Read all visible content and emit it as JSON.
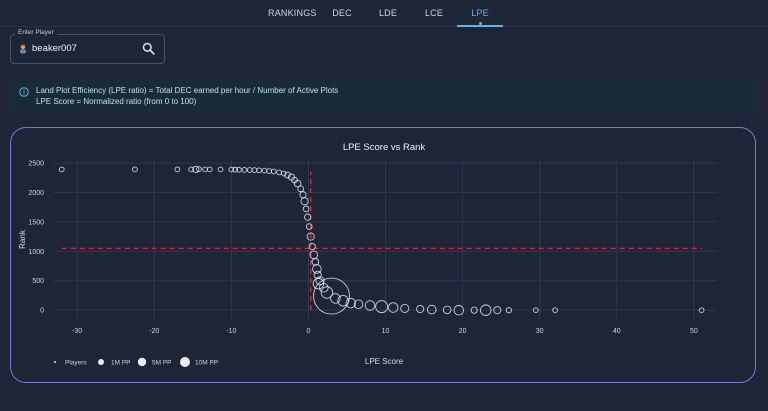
{
  "nav": {
    "tabs": [
      {
        "label": "RANKINGS",
        "active": false
      },
      {
        "label": "DEC",
        "active": false
      },
      {
        "label": "LDE",
        "active": false
      },
      {
        "label": "LCE",
        "active": false
      },
      {
        "label": "LPE",
        "active": true
      }
    ]
  },
  "player": {
    "label": "Enter Player",
    "value": "beaker007"
  },
  "info": {
    "line1": "Land Plot Efficiency (LPE ratio) = Total DEC earned per hour / Number of Active Plots",
    "line2": "LPE Score = Normalized ratio (from 0 to 100)"
  },
  "colors": {
    "background": "#1e2537",
    "accent": "#5fb4e8",
    "card_border": "#7f78d6",
    "info_bg": "#1a2b37",
    "reference_line": "#e0323c"
  },
  "chart_data": {
    "type": "scatter",
    "title": "LPE Score vs Rank",
    "xlabel": "LPE Score",
    "ylabel": "Rank",
    "xlim": [
      -33,
      53
    ],
    "ylim": [
      -150,
      2550
    ],
    "xticks": [
      -30,
      -20,
      -10,
      0,
      10,
      20,
      30,
      40,
      50
    ],
    "yticks": [
      0,
      500,
      1000,
      1500,
      2000,
      2500
    ],
    "grid": true,
    "legend_position": "bottom-left",
    "legend": [
      {
        "label": "Players",
        "marker": "dot"
      },
      {
        "label": "1M PP",
        "marker": "small-circle"
      },
      {
        "label": "5M PP",
        "marker": "medium-circle"
      },
      {
        "label": "10M PP",
        "marker": "large-circle"
      }
    ],
    "reference_lines": [
      {
        "orientation": "horizontal",
        "y": 1050,
        "x_from": -32,
        "x_to": 51
      },
      {
        "orientation": "vertical",
        "x": 0.3,
        "y_from": 0,
        "y_to": 2350
      }
    ],
    "series": [
      {
        "name": "Players",
        "points": [
          {
            "x": -32,
            "y": 2390,
            "size": 1
          },
          {
            "x": -22.5,
            "y": 2390,
            "size": 1
          },
          {
            "x": -17,
            "y": 2390,
            "size": 1
          },
          {
            "x": -15.2,
            "y": 2390,
            "size": 1
          },
          {
            "x": -14.6,
            "y": 2390,
            "size": 1.3
          },
          {
            "x": -14.2,
            "y": 2395,
            "size": 1
          },
          {
            "x": -13.4,
            "y": 2390,
            "size": 1
          },
          {
            "x": -12.8,
            "y": 2390,
            "size": 1
          },
          {
            "x": -11.4,
            "y": 2390,
            "size": 1
          },
          {
            "x": -10,
            "y": 2388,
            "size": 1
          },
          {
            "x": -9.5,
            "y": 2386,
            "size": 1
          },
          {
            "x": -9,
            "y": 2384,
            "size": 1
          },
          {
            "x": -8.3,
            "y": 2382,
            "size": 1
          },
          {
            "x": -7.6,
            "y": 2380,
            "size": 1
          },
          {
            "x": -7,
            "y": 2378,
            "size": 1
          },
          {
            "x": -6.4,
            "y": 2375,
            "size": 1
          },
          {
            "x": -5.7,
            "y": 2370,
            "size": 1
          },
          {
            "x": -5.1,
            "y": 2362,
            "size": 1
          },
          {
            "x": -4.5,
            "y": 2355,
            "size": 1
          },
          {
            "x": -3.8,
            "y": 2340,
            "size": 1
          },
          {
            "x": -3.2,
            "y": 2320,
            "size": 1
          },
          {
            "x": -2.7,
            "y": 2295,
            "size": 1.2
          },
          {
            "x": -2.2,
            "y": 2260,
            "size": 1.3
          },
          {
            "x": -1.8,
            "y": 2210,
            "size": 1.2
          },
          {
            "x": -1.4,
            "y": 2150,
            "size": 1.4
          },
          {
            "x": -1.0,
            "y": 2060,
            "size": 1.2
          },
          {
            "x": -0.7,
            "y": 1960,
            "size": 1.3
          },
          {
            "x": -0.5,
            "y": 1850,
            "size": 1.5
          },
          {
            "x": -0.3,
            "y": 1720,
            "size": 1.2
          },
          {
            "x": -0.1,
            "y": 1580,
            "size": 1.3
          },
          {
            "x": 0.1,
            "y": 1420,
            "size": 1.2
          },
          {
            "x": 0.3,
            "y": 1250,
            "size": 1.5
          },
          {
            "x": 0.5,
            "y": 1080,
            "size": 1.3
          },
          {
            "x": 0.7,
            "y": 940,
            "size": 1.6
          },
          {
            "x": 0.9,
            "y": 820,
            "size": 1.4
          },
          {
            "x": 1.1,
            "y": 700,
            "size": 1.8
          },
          {
            "x": 1.2,
            "y": 600,
            "size": 1.5
          },
          {
            "x": 1.5,
            "y": 500,
            "size": 1.7
          },
          {
            "x": 1.3,
            "y": 450,
            "size": 2.2
          },
          {
            "x": 2.0,
            "y": 380,
            "size": 1.8
          },
          {
            "x": 3.0,
            "y": 240,
            "size": 7.5
          },
          {
            "x": 2.4,
            "y": 300,
            "size": 2.4
          },
          {
            "x": 3.5,
            "y": 200,
            "size": 2.0
          },
          {
            "x": 4.5,
            "y": 160,
            "size": 2.2
          },
          {
            "x": 5.5,
            "y": 120,
            "size": 2.0
          },
          {
            "x": 6.5,
            "y": 100,
            "size": 1.8
          },
          {
            "x": 8,
            "y": 80,
            "size": 2.0
          },
          {
            "x": 9.5,
            "y": 60,
            "size": 2.5
          },
          {
            "x": 11,
            "y": 45,
            "size": 2.0
          },
          {
            "x": 12.5,
            "y": 30,
            "size": 1.7
          },
          {
            "x": 14.5,
            "y": 20,
            "size": 1.5
          },
          {
            "x": 16,
            "y": 10,
            "size": 1.8
          },
          {
            "x": 18,
            "y": 5,
            "size": 1.6
          },
          {
            "x": 19.5,
            "y": 0,
            "size": 2.0
          },
          {
            "x": 21.5,
            "y": 0,
            "size": 1.3
          },
          {
            "x": 23,
            "y": 0,
            "size": 2.2
          },
          {
            "x": 24.5,
            "y": 0,
            "size": 1.5
          },
          {
            "x": 26,
            "y": 0,
            "size": 1.1
          },
          {
            "x": 29.5,
            "y": 0,
            "size": 1
          },
          {
            "x": 32,
            "y": 0,
            "size": 1
          },
          {
            "x": 51,
            "y": 0,
            "size": 1
          }
        ]
      }
    ]
  }
}
